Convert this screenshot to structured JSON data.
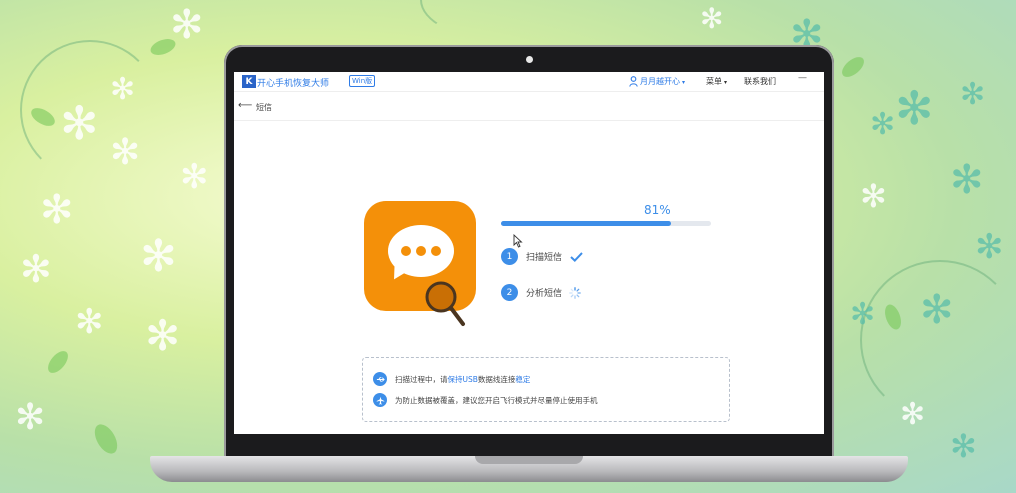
{
  "app": {
    "title": "开心手机恢复大师",
    "edition": "Win版",
    "user_name": "月月越开心",
    "user_caret": "▾",
    "menu_label": "菜单",
    "menu_caret": "▾",
    "contact_label": "联系我们",
    "minimize_label": "—"
  },
  "subbar": {
    "back_label": "⟵",
    "page_title": "短信"
  },
  "progress": {
    "percent_label": "81%",
    "value": 0.81
  },
  "steps": [
    {
      "number": "1",
      "label": "扫描短信",
      "status": "done"
    },
    {
      "number": "2",
      "label": "分析短信",
      "status": "in-progress"
    }
  ],
  "tips": {
    "tip1": {
      "prefix": "扫描过程中，请",
      "highlight1": "保持USB",
      "middle": "数据线连接",
      "highlight2": "稳定"
    },
    "tip2": {
      "text": "为防止数据被覆盖，建议您开启飞行模式并尽量停止使用手机"
    }
  },
  "colors": {
    "accent": "#3d8ee8",
    "sms_icon": "#f49009"
  }
}
